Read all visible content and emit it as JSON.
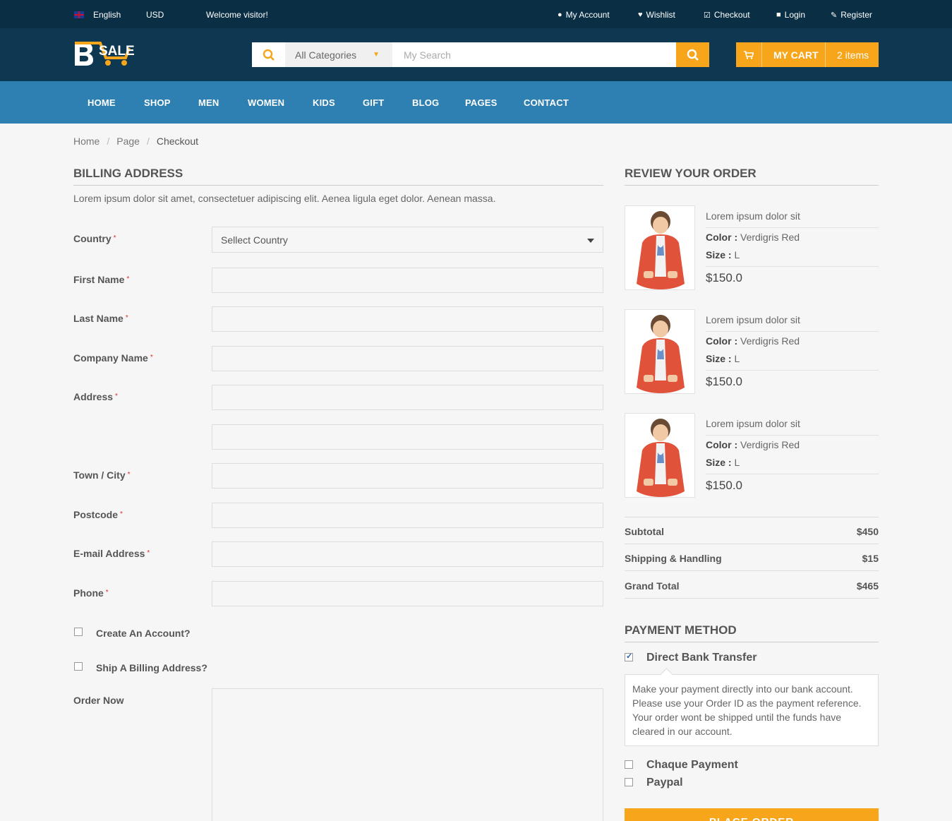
{
  "topbar": {
    "language": "English",
    "currency": "USD",
    "welcome": "Welcome visitor!",
    "links": [
      {
        "icon": "user-icon",
        "label": "My Account"
      },
      {
        "icon": "heart-icon",
        "label": "Wishlist"
      },
      {
        "icon": "check-square-icon",
        "label": "Checkout"
      },
      {
        "icon": "lock-icon",
        "label": "Login"
      },
      {
        "icon": "edit-icon",
        "label": "Register"
      }
    ]
  },
  "header": {
    "logo_text": "SALE",
    "logo_letter": "B",
    "search": {
      "category": "All Categories",
      "placeholder": "My Search"
    },
    "cart": {
      "label": "MY CART",
      "count": "2 items"
    }
  },
  "nav": [
    "HOME",
    "SHOP",
    "MEN",
    "WOMEN",
    "KIDS",
    "GIFT",
    "BLOG",
    "PAGES",
    "CONTACT"
  ],
  "breadcrumb": [
    "Home",
    "Page",
    "Checkout"
  ],
  "billing": {
    "title": "BILLING ADDRESS",
    "intro": "Lorem ipsum dolor sit amet, consectetuer adipiscing elit. Aenea ligula eget dolor. Aenean massa.",
    "country_label": "Country",
    "country_value": "Sellect Country",
    "fields": [
      "First Name",
      "Last Name",
      "Company Name",
      "Address",
      "Town / City",
      "Postcode",
      "E-mail Address",
      "Phone"
    ],
    "required_mark": "*",
    "create_account": "Create An Account?",
    "ship_billing": "Ship A Billing Address?",
    "order_now": "Order Now"
  },
  "review": {
    "title": "REVIEW YOUR ORDER",
    "products": [
      {
        "name": "Lorem ipsum dolor sit",
        "color_label": "Color :",
        "color": "Verdigris Red",
        "size_label": "Size :",
        "size": "L",
        "price": "$150.0"
      },
      {
        "name": "Lorem ipsum dolor sit",
        "color_label": "Color :",
        "color": "Verdigris Red",
        "size_label": "Size :",
        "size": "L",
        "price": "$150.0"
      },
      {
        "name": "Lorem ipsum dolor sit",
        "color_label": "Color :",
        "color": "Verdigris Red",
        "size_label": "Size :",
        "size": "L",
        "price": "$150.0"
      }
    ],
    "totals": [
      {
        "label": "Subtotal",
        "value": "$450"
      },
      {
        "label": "Shipping & Handling",
        "value": "$15"
      },
      {
        "label": "Grand Total",
        "value": "$465"
      }
    ]
  },
  "payment": {
    "title": "PAYMENT METHOD",
    "methods": [
      {
        "label": "Direct Bank Transfer",
        "checked": true
      },
      {
        "label": "Chaque Payment",
        "checked": false
      },
      {
        "label": "Paypal",
        "checked": false
      }
    ],
    "bank_note": "Make your payment directly into our bank account. Please use your Order ID as the payment reference. Your order wont be shipped until the funds have cleared in our account.",
    "place_order": "PLACE ORDER"
  },
  "colors": {
    "topbar": "#0a2f45",
    "header": "#0e3852",
    "nav": "#2f80b2",
    "accent": "#f7a51a",
    "required": "#e02d2d"
  }
}
